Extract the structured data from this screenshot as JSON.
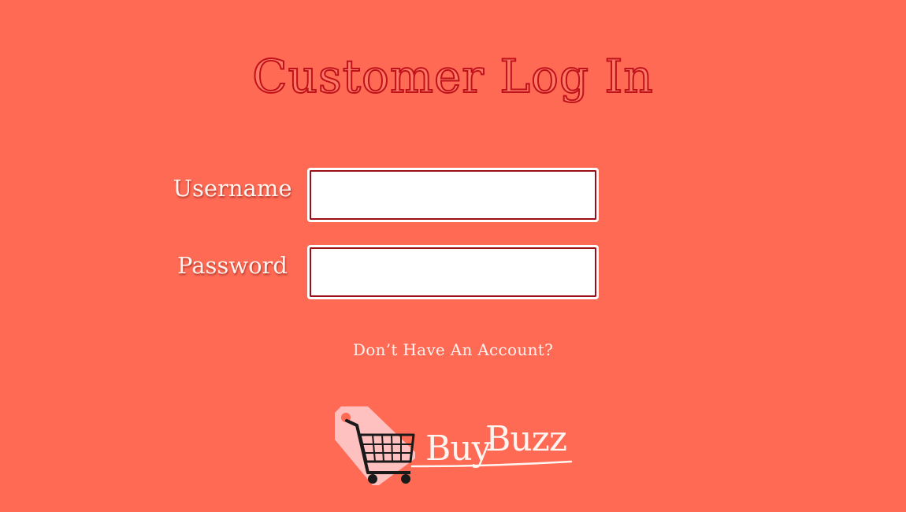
{
  "page": {
    "title": "Customer Log In",
    "background_color": "#ff6a55"
  },
  "form": {
    "username_label": "Username",
    "username_value": "",
    "password_label": "Password",
    "password_value": ""
  },
  "links": {
    "signup_text": "Don’t Have An Account?"
  },
  "logo": {
    "brand_part1": "Buy",
    "brand_part2": "Buzz",
    "icon": "shopping-cart-tag-icon",
    "tag_color": "#ffc0c0",
    "cart_color": "#1a1a1a"
  }
}
